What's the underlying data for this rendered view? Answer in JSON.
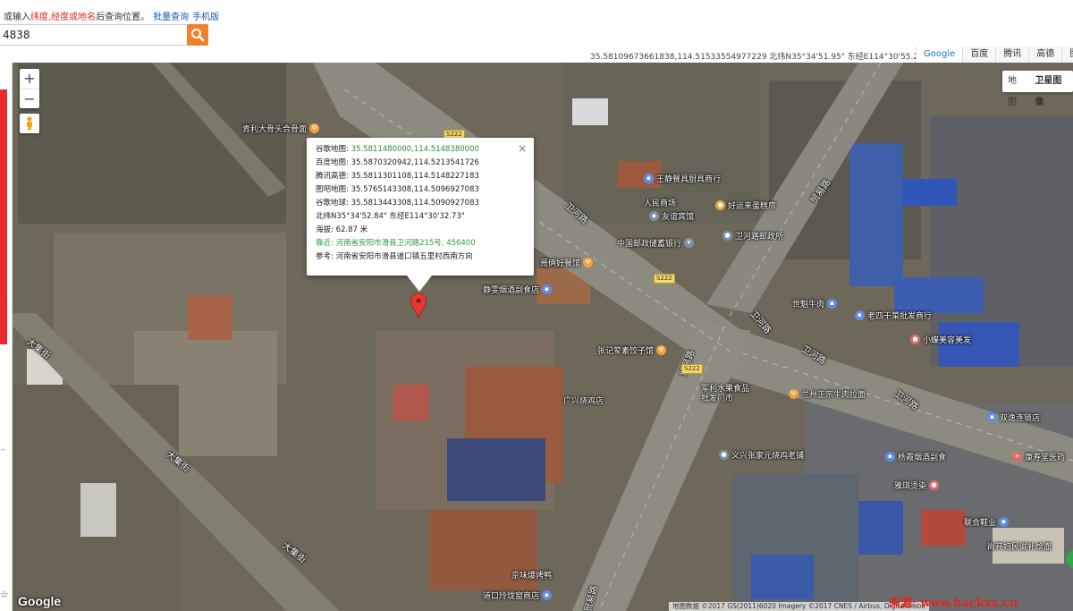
{
  "topbar": {
    "hint_prefix": "或输入",
    "hint_red": "纬度,经度或地名",
    "hint_suffix": "后查询位置。",
    "batch_link": "批量查询",
    "mobile_link": "手机版",
    "search_value": "4838",
    "coord_readout": "35.58109673661838,114.51533554977229 北纬N35°34'51.95\" 东经E114°30'55.21\"",
    "provider_tabs": [
      "Google",
      "百度",
      "腾讯",
      "高德",
      "图吧"
    ],
    "active_provider": "Google"
  },
  "map_type": {
    "options": [
      "地图",
      "卫星图像"
    ],
    "active": "卫星图像"
  },
  "controls": {
    "zoom_in": "+",
    "zoom_out": "−"
  },
  "infowindow": {
    "close": "×",
    "rows": [
      {
        "label": "谷歌地图:",
        "value": "35.5811480000,114.5148380000"
      },
      {
        "label": "百度地图:",
        "value": "35.5870320942,114.5213541726"
      },
      {
        "label": "腾讯高德:",
        "value": "35.5811301108,114.5148227183"
      },
      {
        "label": "图吧地图:",
        "value": "35.5765143308,114.5096927083"
      },
      {
        "label": "谷歌地球:",
        "value": "35.5813443308,114.5090927083"
      }
    ],
    "dms": "北纬N35°34'52.84\" 东经E114°30'32.73\"",
    "altitude": "海拔: 62.87 米",
    "nearby": "靠近: 河南省安阳市滑县卫河路215号, 456400",
    "reference": "参考: 河南省安阳市滑县道口镇五里村西南方向"
  },
  "pois": [
    {
      "name": "青利大骨头合骨面",
      "icon": "restaurant-icon"
    },
    {
      "name": "王静餐具厨具商行",
      "icon": "shop-icon"
    },
    {
      "name": "人民商场",
      "icon": ""
    },
    {
      "name": "友谊宾馆",
      "icon": "hotel-icon"
    },
    {
      "name": "好运来蛋糕房",
      "icon": "bakery-icon"
    },
    {
      "name": "中国邮政储蓄银行",
      "icon": "bank-icon"
    },
    {
      "name": "卫河路邮政所",
      "icon": "post-icon"
    },
    {
      "name": "哥俩好餐馆",
      "icon": "restaurant-icon"
    },
    {
      "name": "静雯烟酒副食店",
      "icon": "shop-icon"
    },
    {
      "name": "世魁牛肉",
      "icon": "shop-icon"
    },
    {
      "name": "老四干菜批发商行",
      "icon": "shop-icon"
    },
    {
      "name": "小蝶美容美发",
      "icon": "salon-icon"
    },
    {
      "name": "张记荤素饺子馆",
      "icon": "restaurant-icon"
    },
    {
      "name": "军利水果食品批发门市",
      "icon": "shop-icon"
    },
    {
      "name": "兰州正宗牛肉拉面",
      "icon": "restaurant-icon"
    },
    {
      "name": "广兴烧鸡店",
      "icon": ""
    },
    {
      "name": "双逸连锁店",
      "icon": "shop-icon"
    },
    {
      "name": "义兴张家元烧鸡老铺",
      "icon": ""
    },
    {
      "name": "杨霞烟酒副食",
      "icon": "shop-icon"
    },
    {
      "name": "康寿堂医药",
      "icon": "pharmacy-icon"
    },
    {
      "name": "雅琪烫染",
      "icon": "salon-icon"
    },
    {
      "name": "联合鞋业",
      "icon": "shop-icon"
    },
    {
      "name": "尚开妇民滋补烩面",
      "icon": "restaurant-icon"
    },
    {
      "name": "京味爆烤鸭",
      "icon": ""
    },
    {
      "name": "道口玲珑窗商店",
      "icon": "shop-icon"
    }
  ],
  "roads": [
    "贸易路",
    "卫河路",
    "卫河路",
    "卫河路",
    "贸易路",
    "卫河路",
    "大集街",
    "大集街",
    "大集街",
    "贸易路"
  ],
  "shields": [
    "S222",
    "S222",
    "S222"
  ],
  "google_logo": "Google",
  "attribution": "地图数据 ©2017 GS(2011)6020 Imagery ©2017 CNES / Airbus, DigitalGlobe",
  "watermark": "来源: www.hackxx.cn",
  "colors": {
    "accent": "#f0812c",
    "link": "#1a55b5",
    "marker": "#e53935",
    "hint_red": "#e0261c"
  }
}
